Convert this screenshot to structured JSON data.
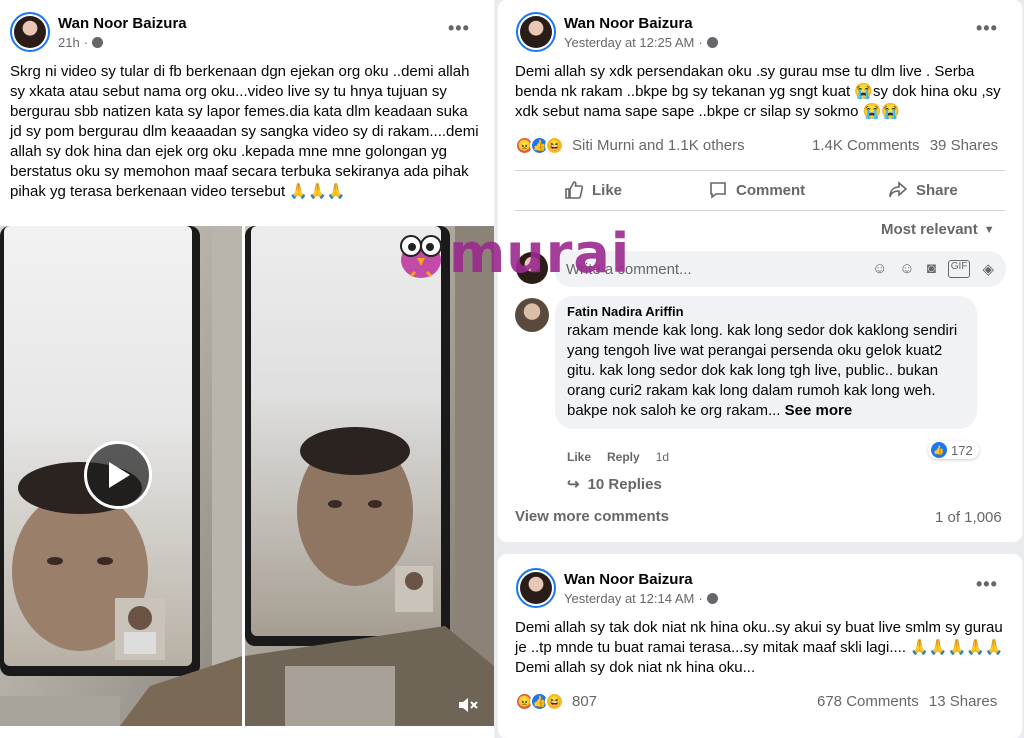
{
  "left_post": {
    "author": "Wan Noor Baizura",
    "time": "21h",
    "text": "Skrg ni video sy tular di fb berkenaan dgn ejekan org oku ..demi allah sy xkata atau sebut nama org oku...video live sy tu hnya tujuan sy bergurau sbb natizen kata sy lapor femes.dia kata dlm keadaan suka jd sy pom bergurau dlm keaaadan sy sangka video sy di rakam....demi allah sy dok hina dan ejek org oku .kepada mne mne golongan yg berstatus oku sy memohon maaf secara terbuka sekiranya ada pihak pihak yg terasa berkenaan video tersebut 🙏🙏🙏",
    "more_icon": "three-dots-icon",
    "play_icon": "play-icon",
    "mute_icon": "speaker-muted-icon"
  },
  "watermark": {
    "text": "murai",
    "color": "#9b2a8e",
    "mascot": "owl-mascot-icon"
  },
  "post1": {
    "author": "Wan Noor Baizura",
    "time": "Yesterday at 12:25 AM",
    "text": "Demi allah sy xdk persendakan oku .sy gurau mse tu dlm live . Serba benda nk rakam ..bkpe bg sy tekanan yg sngt kuat 😭sy dok hina oku ,sy xdk sebut nama sape sape ..bkpe cr silap sy sokmo 😭😭",
    "reactions_text": "Siti Murni and 1.1K others",
    "comments": "1.4K Comments",
    "shares": "39 Shares",
    "actions": {
      "like": "Like",
      "comment": "Comment",
      "share": "Share"
    },
    "sort": "Most relevant",
    "comment_placeholder": "Write a comment...",
    "comment": {
      "author": "Fatin Nadira Ariffin",
      "text": "rakam mende kak long. kak long sedor dok kaklong sendiri yang tengoh live wat perangai persenda oku gelok kuat2 gitu. kak long sedor dok kak long tgh live, public.. bukan orang curi2 rakam kak long dalam rumoh kak long weh. bakpe nok saloh ke org rakam...",
      "see_more": "See more",
      "like": "Like",
      "reply": "Reply",
      "age": "1d",
      "like_count": "172",
      "replies": "10 Replies"
    },
    "view_more": "View more comments",
    "pagination": "1 of 1,006"
  },
  "post2": {
    "author": "Wan Noor Baizura",
    "time": "Yesterday at 12:14 AM",
    "text": "Demi allah sy tak dok niat nk hina oku..sy akui sy buat live smlm sy gurau je ..tp mnde tu buat ramai terasa...sy mitak maaf skli lagi.... 🙏🙏🙏🙏🙏Demi allah sy dok niat nk hina oku...",
    "reactions_count": "807",
    "comments": "678 Comments",
    "shares": "13 Shares"
  },
  "colors": {
    "facebook_blue": "#1877f2",
    "secondary_text": "#65676b",
    "bubble_bg": "#f0f2f5"
  }
}
